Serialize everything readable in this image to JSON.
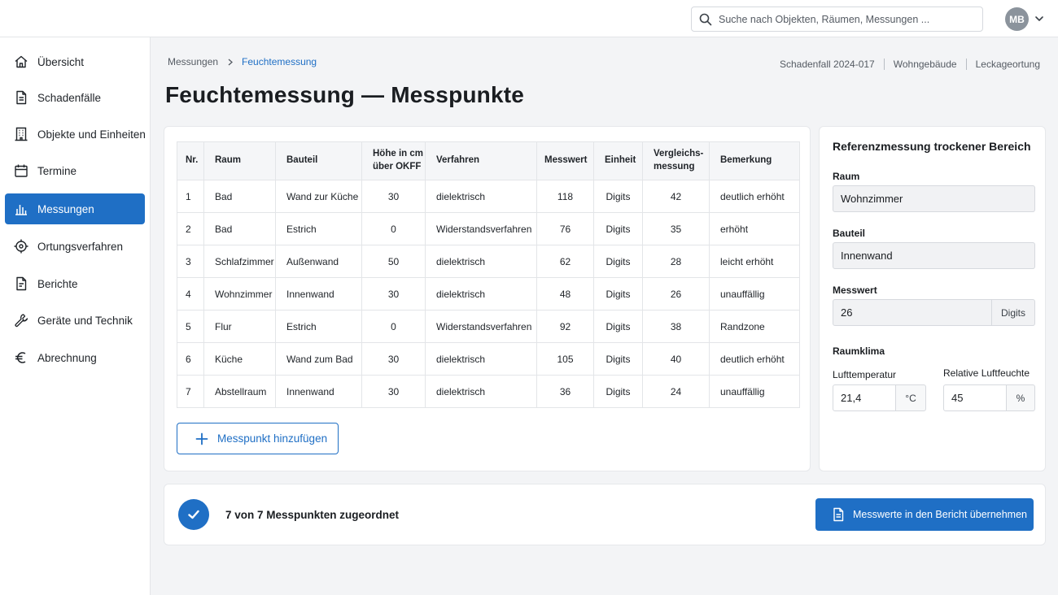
{
  "search": {
    "placeholder": "Suche nach Objekten, Räumen, Messungen ..."
  },
  "user": {
    "initials": "MB"
  },
  "sidebar": {
    "items": [
      {
        "label": "Übersicht",
        "icon": "home-icon"
      },
      {
        "label": "Schadenfälle",
        "icon": "document-icon"
      },
      {
        "label": "Objekte und Einheiten",
        "icon": "building-icon"
      },
      {
        "label": "Termine",
        "icon": "calendar-icon"
      },
      {
        "label": "Messungen",
        "icon": "bar-chart-icon",
        "active": true
      },
      {
        "label": "Ortungsverfahren",
        "icon": "crosshair-icon"
      },
      {
        "label": "Berichte",
        "icon": "report-icon"
      },
      {
        "label": "Geräte und Technik",
        "icon": "wrench-icon"
      },
      {
        "label": "Abrechnung",
        "icon": "euro-icon"
      }
    ]
  },
  "breadcrumb": {
    "parent": "Messungen",
    "current": "Feuchtemessung"
  },
  "context": {
    "case": "Schadenfall 2024-017",
    "building": "Wohngebäude",
    "type": "Leckageortung"
  },
  "page": {
    "title": "Feuchtemessung — Messpunkte"
  },
  "table": {
    "headers": {
      "nr": "Nr.",
      "raum": "Raum",
      "bauteil": "Bauteil",
      "hoehe_1": "Höhe in cm",
      "hoehe_2": "über OKFF",
      "verfahren": "Verfahren",
      "messwert": "Messwert",
      "einheit": "Einheit",
      "vergleich_1": "Vergleichs-",
      "vergleich_2": "messung",
      "bemerkung": "Bemerkung"
    },
    "rows": [
      {
        "nr": "1",
        "raum": "Bad",
        "bauteil": "Wand zur Küche",
        "hoehe": "30",
        "verfahren": "dielektrisch",
        "messwert": "118",
        "einheit": "Digits",
        "vergleich": "42",
        "bemerkung": "deutlich erhöht"
      },
      {
        "nr": "2",
        "raum": "Bad",
        "bauteil": "Estrich",
        "hoehe": "0",
        "verfahren": "Widerstandsverfahren",
        "messwert": "76",
        "einheit": "Digits",
        "vergleich": "35",
        "bemerkung": "erhöht"
      },
      {
        "nr": "3",
        "raum": "Schlafzimmer",
        "bauteil": "Außenwand",
        "hoehe": "50",
        "verfahren": "dielektrisch",
        "messwert": "62",
        "einheit": "Digits",
        "vergleich": "28",
        "bemerkung": "leicht erhöht"
      },
      {
        "nr": "4",
        "raum": "Wohnzimmer",
        "bauteil": "Innenwand",
        "hoehe": "30",
        "verfahren": "dielektrisch",
        "messwert": "48",
        "einheit": "Digits",
        "vergleich": "26",
        "bemerkung": "unauffällig"
      },
      {
        "nr": "5",
        "raum": "Flur",
        "bauteil": "Estrich",
        "hoehe": "0",
        "verfahren": "Widerstandsverfahren",
        "messwert": "92",
        "einheit": "Digits",
        "vergleich": "38",
        "bemerkung": "Randzone"
      },
      {
        "nr": "6",
        "raum": "Küche",
        "bauteil": "Wand zum Bad",
        "hoehe": "30",
        "verfahren": "dielektrisch",
        "messwert": "105",
        "einheit": "Digits",
        "vergleich": "40",
        "bemerkung": "deutlich erhöht"
      },
      {
        "nr": "7",
        "raum": "Abstellraum",
        "bauteil": "Innenwand",
        "hoehe": "30",
        "verfahren": "dielektrisch",
        "messwert": "36",
        "einheit": "Digits",
        "vergleich": "24",
        "bemerkung": "unauffällig"
      }
    ],
    "add_label": "Messpunkt hinzufügen"
  },
  "reference": {
    "title": "Referenzmessung trockener Bereich",
    "raum_label": "Raum",
    "raum_value": "Wohnzimmer",
    "bauteil_label": "Bauteil",
    "bauteil_value": "Innenwand",
    "messwert_label": "Messwert",
    "messwert_value": "26",
    "messwert_unit": "Digits",
    "klima_label": "Raumklima",
    "temp_label": "Lufttemperatur",
    "temp_value": "21,4",
    "temp_unit": "°C",
    "humidity_label": "Relative Luftfeuchte",
    "humidity_value": "45",
    "humidity_unit": "%"
  },
  "status": {
    "text": "7 von 7 Messpunkten zugeordnet",
    "button_label": "Messwerte in den Bericht übernehmen"
  },
  "colors": {
    "accent": "#1f6fc5",
    "background": "#f3f4f6"
  }
}
